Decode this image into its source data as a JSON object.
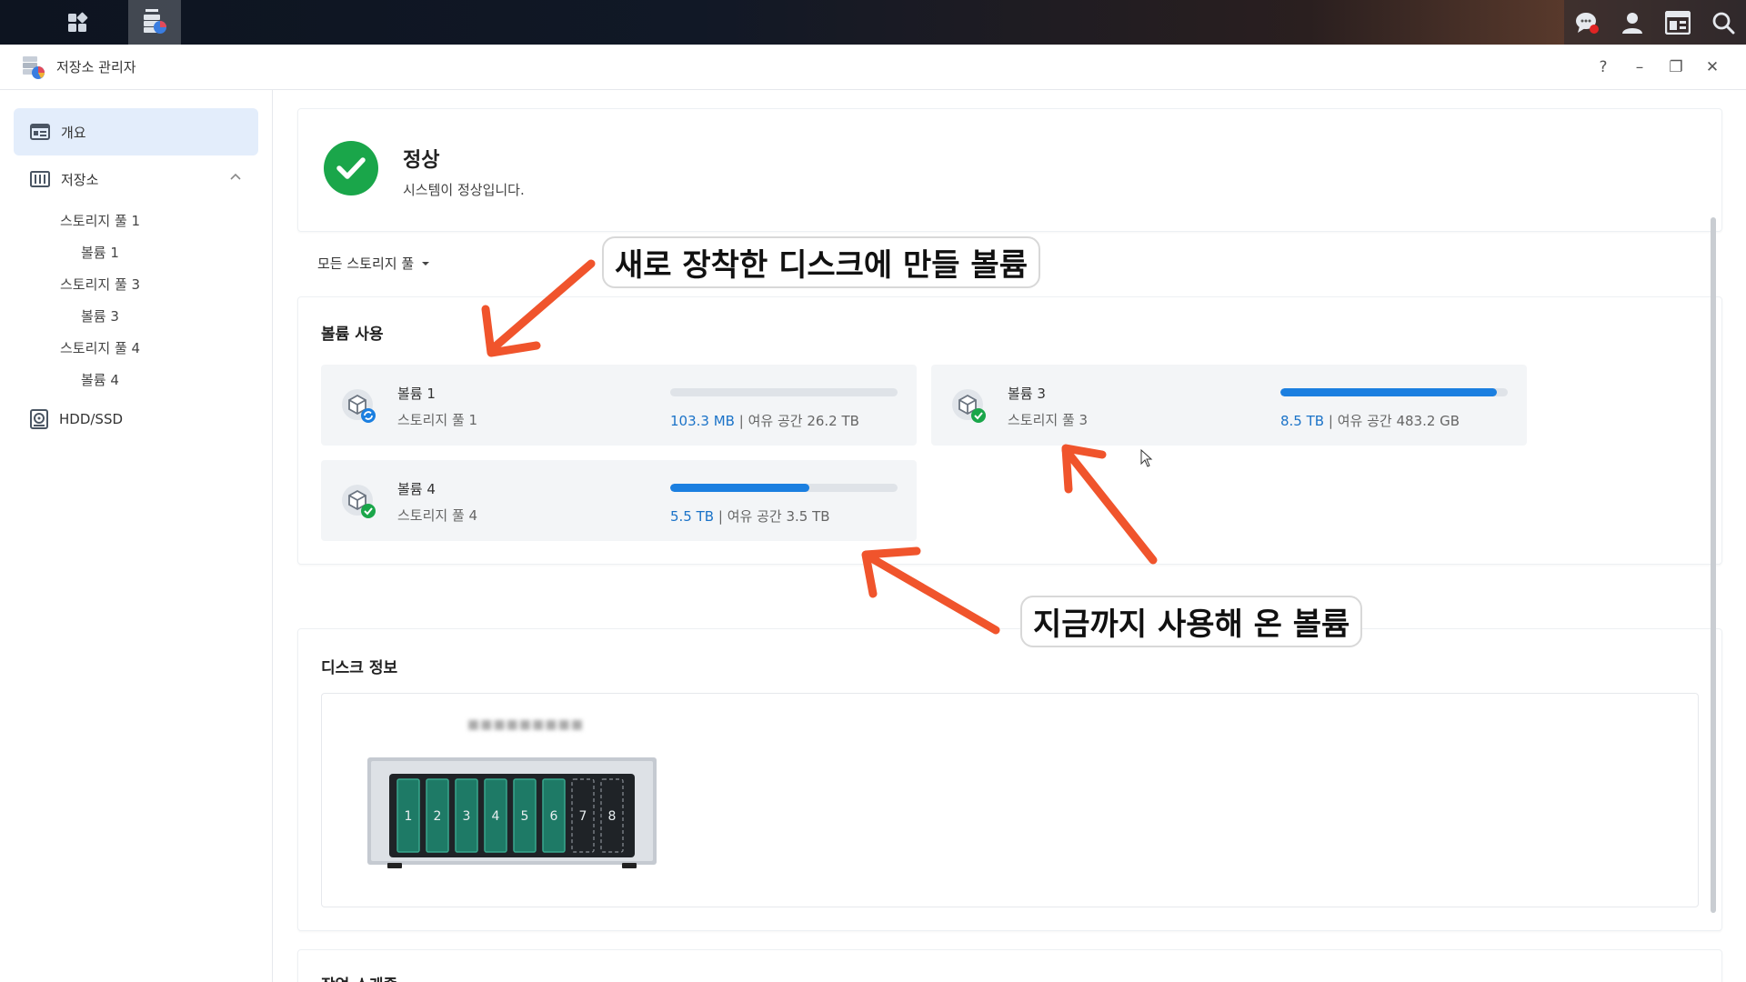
{
  "taskbar": {
    "apps": [
      {
        "name": "main-menu"
      },
      {
        "name": "storage-manager",
        "active": true
      }
    ],
    "right_icons": [
      "chat-icon",
      "user-icon",
      "widgets-icon",
      "search-icon"
    ]
  },
  "window": {
    "title": "저장소 관리자",
    "controls": {
      "help": "?",
      "minimize": "–",
      "restore": "❐",
      "close": "✕"
    }
  },
  "sidebar": {
    "overview": "개요",
    "storage": "저장소",
    "tree": [
      {
        "label": "스토리지 풀 1",
        "level": 1
      },
      {
        "label": "볼륨 1",
        "level": 2
      },
      {
        "label": "스토리지 풀 3",
        "level": 1
      },
      {
        "label": "볼륨 3",
        "level": 2
      },
      {
        "label": "스토리지 풀 4",
        "level": 1
      },
      {
        "label": "볼륨 4",
        "level": 2
      }
    ],
    "hdd": "HDD/SSD"
  },
  "status": {
    "title": "정상",
    "description": "시스템이 정상입니다."
  },
  "filter": {
    "label": "모든 스토리지 풀"
  },
  "volume_usage": {
    "heading": "볼륨 사용",
    "volumes": [
      {
        "name": "볼륨 1",
        "pool": "스토리지 풀 1",
        "used": "103.3 MB",
        "separator": "|",
        "free": "여유 공간 26.2 TB",
        "used_fraction": 0.0,
        "status": "syncing"
      },
      {
        "name": "볼륨 3",
        "pool": "스토리지 풀 3",
        "used": "8.5 TB",
        "separator": "|",
        "free": "여유 공간 483.2 GB",
        "used_fraction": 0.95,
        "status": "healthy"
      },
      {
        "name": "볼륨 4",
        "pool": "스토리지 풀 4",
        "used": "5.5 TB",
        "separator": "|",
        "free": "여유 공간 3.5 TB",
        "used_fraction": 0.61,
        "status": "healthy"
      }
    ]
  },
  "disk_info": {
    "heading": "디스크 정보",
    "bays": [
      "1",
      "2",
      "3",
      "4",
      "5",
      "6",
      "7",
      "8"
    ],
    "filled_bays": 6
  },
  "schedule": {
    "heading": "작업 스케줄"
  },
  "annotations": {
    "top": "새로 장착한 디스크에 만들 볼륨",
    "bottom": "지금까지 사용해 온 볼륨"
  },
  "colors": {
    "accent": "#1b7fe0",
    "healthy": "#1aa64a",
    "annotation_arrow": "#f0542c"
  }
}
